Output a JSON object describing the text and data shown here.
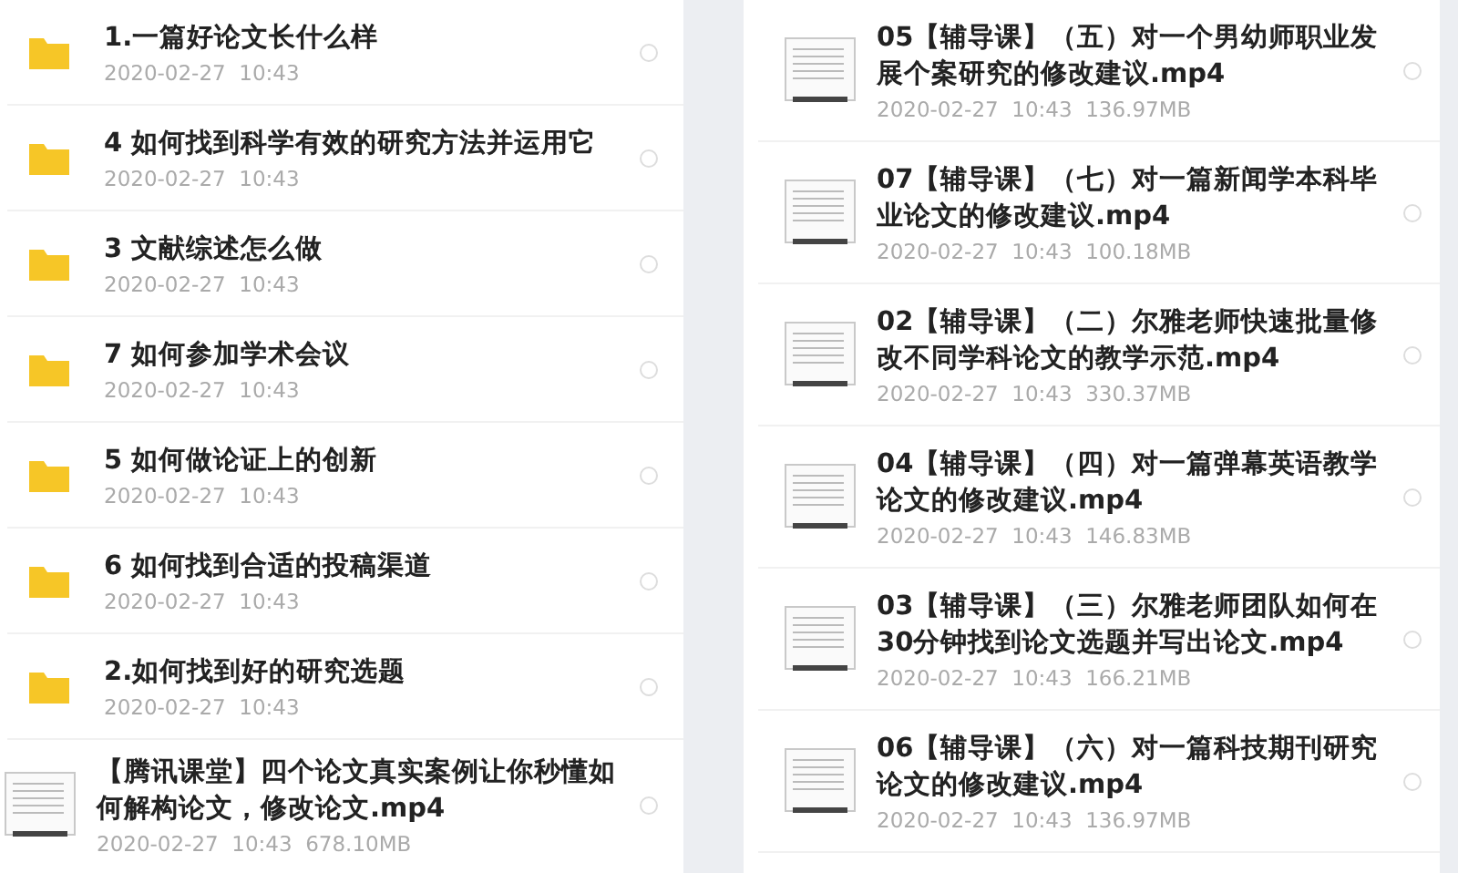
{
  "left_list": {
    "items": [
      {
        "kind": "folder",
        "title": "1.一篇好论文长什么样",
        "date": "2020-02-27  10:43",
        "selected": false
      },
      {
        "kind": "folder",
        "title": "4 如何找到科学有效的研究方法并运用它",
        "date": "2020-02-27  10:43",
        "selected": false
      },
      {
        "kind": "folder",
        "title": "3 文献综述怎么做",
        "date": "2020-02-27  10:43",
        "selected": false
      },
      {
        "kind": "folder",
        "title": "7 如何参加学术会议",
        "date": "2020-02-27  10:43",
        "selected": false
      },
      {
        "kind": "folder",
        "title": "5 如何做论证上的创新",
        "date": "2020-02-27  10:43",
        "selected": false
      },
      {
        "kind": "folder",
        "title": "6 如何找到合适的投稿渠道",
        "date": "2020-02-27  10:43",
        "selected": false
      },
      {
        "kind": "folder",
        "title": "2.如何找到好的研究选题",
        "date": "2020-02-27  10:43",
        "selected": false
      },
      {
        "kind": "video",
        "title": "【腾讯课堂】四个论文真实案例让你秒懂如何解构论文，修改论文.mp4",
        "date": "2020-02-27  10:43",
        "size": "678.10MB",
        "selected": false
      }
    ]
  },
  "right_list": {
    "items": [
      {
        "kind": "video",
        "title": "05【辅导课】（五）对一个男幼师职业发展个案研究的修改建议.mp4",
        "date": "2020-02-27  10:43",
        "size": "136.97MB",
        "selected": false
      },
      {
        "kind": "video",
        "title": "07【辅导课】（七）对一篇新闻学本科毕业论文的修改建议.mp4",
        "date": "2020-02-27  10:43",
        "size": "100.18MB",
        "selected": false
      },
      {
        "kind": "video",
        "title": "02【辅导课】（二）尔雅老师快速批量修改不同学科论文的教学示范.mp4",
        "date": "2020-02-27  10:43",
        "size": "330.37MB",
        "selected": false
      },
      {
        "kind": "video",
        "title": "04【辅导课】（四）对一篇弹幕英语教学论文的修改建议.mp4",
        "date": "2020-02-27  10:43",
        "size": "146.83MB",
        "selected": false
      },
      {
        "kind": "video",
        "title": "03【辅导课】（三）尔雅老师团队如何在30分钟找到论文选题并写出论文.mp4",
        "date": "2020-02-27  10:43",
        "size": "166.21MB",
        "selected": false
      },
      {
        "kind": "video",
        "title": "06【辅导课】（六）对一篇科技期刊研究论文的修改建议.mp4",
        "date": "2020-02-27  10:43",
        "size": "136.97MB",
        "selected": false
      }
    ]
  }
}
